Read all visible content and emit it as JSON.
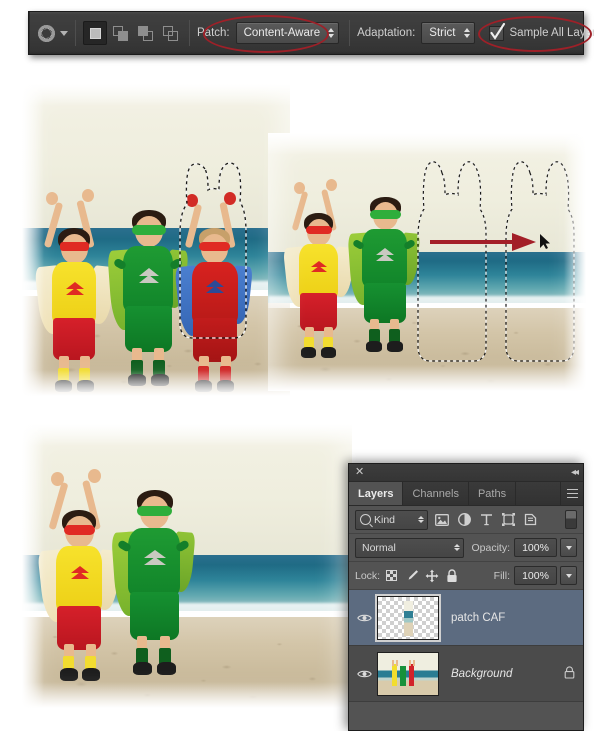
{
  "options_bar": {
    "tool_icon": "patch-tool-icon",
    "tool_preset_caret": "preset-picker-caret",
    "selection_modes": [
      {
        "name": "new-selection",
        "label": "New selection",
        "active": true
      },
      {
        "name": "add-to-selection",
        "label": "Add to selection",
        "active": false
      },
      {
        "name": "subtract-from-selection",
        "label": "Subtract from selection",
        "active": false
      },
      {
        "name": "intersect-with-selection",
        "label": "Intersect with selection",
        "active": false
      }
    ],
    "patch_label": "Patch:",
    "patch_value": "Content-Aware",
    "adaptation_label": "Adaptation:",
    "adaptation_value": "Strict",
    "sample_all_layers_label": "Sample All Layers",
    "sample_all_layers_checked": true,
    "annotation_color": "#9e2028"
  },
  "figures": {
    "figure_1": {
      "name": "original-photo-with-selection",
      "description": "Three children in superhero costumes on a beach; the red-caped child at right is enclosed in a marching-ants selection."
    },
    "figure_2": {
      "name": "patch-drag-photo",
      "description": "Selection dragged to the right across clean sand and sea; the red child has been replaced by content-aware fill.",
      "arrow_color": "#a31f28"
    },
    "figure_3": {
      "name": "result-photo",
      "description": "Final result: only the yellow and green costumed children remain on the beach."
    }
  },
  "layers_panel": {
    "close_icon": "close-icon",
    "collapse_icon": "collapse-to-icons-icon",
    "menu_icon": "panel-menu-icon",
    "tabs": [
      {
        "label": "Layers",
        "active": true
      },
      {
        "label": "Channels",
        "active": false
      },
      {
        "label": "Paths",
        "active": false
      }
    ],
    "filter": {
      "kind_label": "Kind",
      "icons": [
        "filter-pixel-layers-icon",
        "filter-adjustment-layers-icon",
        "filter-type-layers-icon",
        "filter-shape-layers-icon",
        "filter-smart-object-layers-icon"
      ],
      "toggle": "filter-enable-toggle"
    },
    "blend_mode": "Normal",
    "opacity_label": "Opacity:",
    "opacity_value": "100%",
    "lock_label": "Lock:",
    "lock_icons": [
      "lock-transparent-pixels-icon",
      "lock-image-pixels-icon",
      "lock-position-icon",
      "lock-all-icon"
    ],
    "fill_label": "Fill:",
    "fill_value": "100%",
    "layers": [
      {
        "name": "patch CAF",
        "selected": true,
        "visible": true,
        "locked": false,
        "thumbnail": "transparent-patch-thumbnail"
      },
      {
        "name": "Background",
        "selected": false,
        "visible": true,
        "locked": true,
        "thumbnail": "background-photo-thumbnail"
      }
    ]
  }
}
